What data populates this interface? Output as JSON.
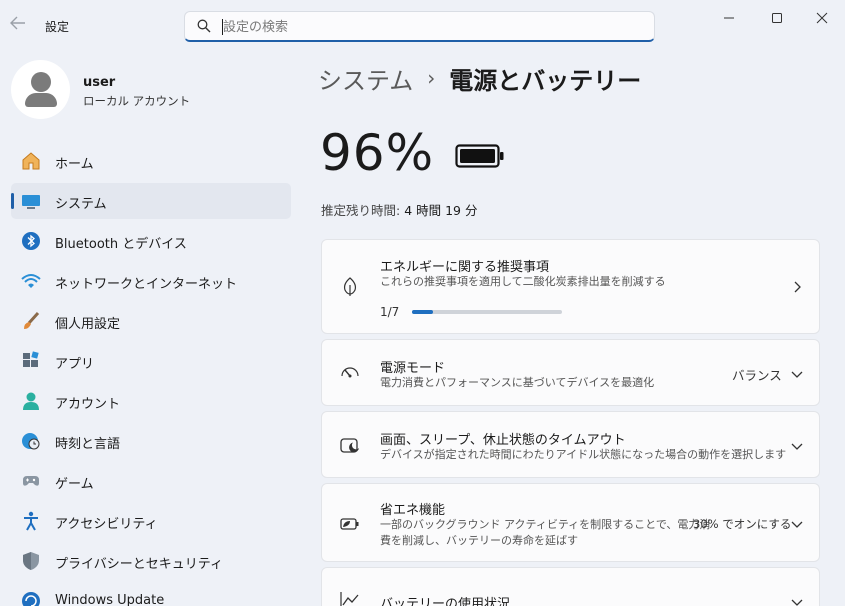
{
  "window": {
    "title": "設定"
  },
  "search": {
    "placeholder": "設定の検索",
    "value": ""
  },
  "profile": {
    "name": "user",
    "account_type": "ローカル アカウント"
  },
  "sidebar": {
    "items": [
      {
        "label": "ホーム",
        "icon": "home-icon",
        "active": false
      },
      {
        "label": "システム",
        "icon": "system-icon",
        "active": true
      },
      {
        "label": "Bluetooth とデバイス",
        "icon": "bluetooth-icon",
        "active": false
      },
      {
        "label": "ネットワークとインターネット",
        "icon": "wifi-icon",
        "active": false
      },
      {
        "label": "個人用設定",
        "icon": "brush-icon",
        "active": false
      },
      {
        "label": "アプリ",
        "icon": "apps-icon",
        "active": false
      },
      {
        "label": "アカウント",
        "icon": "account-icon",
        "active": false
      },
      {
        "label": "時刻と言語",
        "icon": "globe-clock-icon",
        "active": false
      },
      {
        "label": "ゲーム",
        "icon": "gamepad-icon",
        "active": false
      },
      {
        "label": "アクセシビリティ",
        "icon": "accessibility-icon",
        "active": false
      },
      {
        "label": "プライバシーとセキュリティ",
        "icon": "shield-icon",
        "active": false
      },
      {
        "label": "Windows Update",
        "icon": "update-icon",
        "active": false
      }
    ]
  },
  "breadcrumb": {
    "parent": "システム",
    "separator": "›",
    "current": "電源とバッテリー"
  },
  "battery": {
    "percent_text": "96%",
    "estimate_label": "推定残り時間:",
    "estimate_value": "4 時間 19 分"
  },
  "cards": {
    "energy": {
      "title": "エネルギーに関する推奨事項",
      "subtitle": "これらの推奨事項を適用して二酸化炭素排出量を削減する",
      "progress_text": "1/7",
      "progress_fraction": 0.143
    },
    "power_mode": {
      "title": "電源モード",
      "subtitle": "電力消費とパフォーマンスに基づいてデバイスを最適化",
      "value": "バランス"
    },
    "timeout": {
      "title": "画面、スリープ、休止状態のタイムアウト",
      "subtitle": "デバイスが指定された時間にわたりアイドル状態になった場合の動作を選択します"
    },
    "saver": {
      "title": "省エネ機能",
      "subtitle_line1": "一部のバックグラウンド アクティビティを制限することで、電力消",
      "subtitle_line2": "費を削減し、バッテリーの寿命を延ばす",
      "value": "30% でオンにする"
    },
    "usage": {
      "title": "バッテリーの使用状況"
    }
  },
  "colors": {
    "accent": "#1f6fc0",
    "background": "#eef1f7",
    "card": "#fbfbfc"
  }
}
